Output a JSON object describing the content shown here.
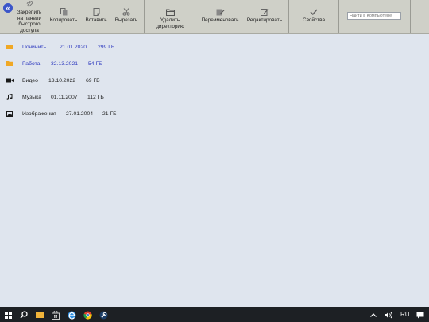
{
  "ribbon": {
    "pin": "Закрепить на панели быстрого доступа",
    "copy": "Копировать",
    "paste": "Вставить",
    "cut": "Вырезать",
    "delete_dir": "Удалить директорию",
    "rename": "Переименовать",
    "edit": "Редактировать",
    "properties": "Свойства",
    "search_placeholder": "Найти в Компьютере"
  },
  "files": [
    {
      "name": "Починить",
      "date": "21.01.2020",
      "size": "299 ГБ",
      "icon": "folder-icon"
    },
    {
      "name": "Работа",
      "date": "32.13.2021",
      "size": "54 ГБ",
      "icon": "folder-icon"
    },
    {
      "name": "Видео",
      "date": "13.10.2022",
      "size": "69 ГБ",
      "icon": "video-icon"
    },
    {
      "name": "Музыка",
      "date": "01.11.2007",
      "size": "112 ГБ",
      "icon": "music-icon"
    },
    {
      "name": "Изображения",
      "date": "27.01.2004",
      "size": "21 ГБ",
      "icon": "image-icon"
    }
  ],
  "taskbar": {
    "language": "RU"
  },
  "colors": {
    "ribbon_bg": "#cfd0c8",
    "content_bg": "#dfe5ee",
    "folder_text": "#2f3bbf",
    "folder_icon": "#f0a825",
    "taskbar_bg": "#1d2024"
  }
}
